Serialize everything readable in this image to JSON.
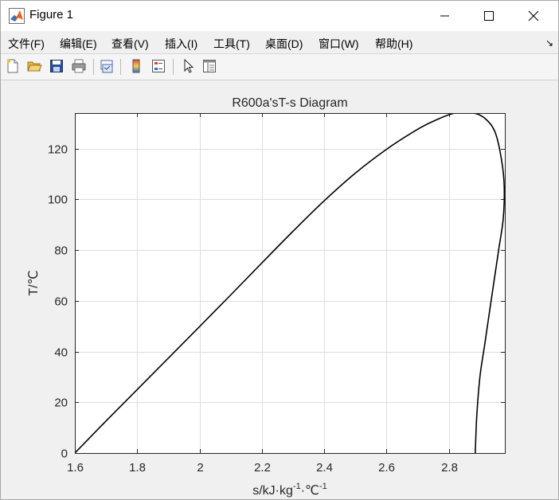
{
  "window": {
    "title": "Figure 1"
  },
  "menu": {
    "items": [
      {
        "label": "文件(F)"
      },
      {
        "label": "编辑(E)"
      },
      {
        "label": "查看(V)"
      },
      {
        "label": "插入(I)"
      },
      {
        "label": "工具(T)"
      },
      {
        "label": "桌面(D)"
      },
      {
        "label": "窗口(W)"
      },
      {
        "label": "帮助(H)"
      }
    ],
    "overflow_icon": "dock-arrow-icon"
  },
  "toolbar": {
    "icons": [
      "new-figure-icon",
      "open-file-icon",
      "save-icon",
      "print-icon",
      "link-plot-icon",
      "insert-colorbar-icon",
      "insert-legend-icon",
      "edit-plot-icon",
      "property-inspector-icon"
    ]
  },
  "chart_data": {
    "type": "line",
    "title": "R600a'sT-s Diagram",
    "xlabel_main": "s/kJ·kg",
    "xlabel_sup1": "-1",
    "xlabel_mid": "·℃",
    "xlabel_sup2": "-1",
    "ylabel": "T/℃",
    "xlim": [
      1.6,
      2.98
    ],
    "ylim": [
      0,
      134
    ],
    "xticks": [
      1.6,
      1.8,
      2,
      2.2,
      2.4,
      2.6,
      2.8
    ],
    "xtick_labels": [
      "1.6",
      "1.8",
      "2",
      "2.2",
      "2.4",
      "2.6",
      "2.8"
    ],
    "yticks": [
      0,
      20,
      40,
      60,
      80,
      100,
      120
    ],
    "ytick_labels": [
      "0",
      "20",
      "40",
      "60",
      "80",
      "100",
      "120"
    ],
    "grid": true,
    "line_color": "#000000",
    "series": [
      {
        "x": [
          1.6,
          1.7,
          1.8,
          1.9,
          2.0,
          2.1,
          2.2,
          2.3,
          2.4,
          2.5,
          2.6,
          2.7,
          2.76,
          2.82,
          2.88,
          2.92,
          2.95,
          2.97,
          2.978,
          2.975,
          2.96,
          2.945,
          2.93,
          2.915,
          2.9,
          2.89,
          2.885
        ],
        "y": [
          0,
          12.6,
          25.0,
          37.4,
          49.8,
          62.3,
          74.9,
          87.4,
          99.4,
          110.3,
          119.7,
          127.6,
          131.3,
          134,
          134,
          131.5,
          126,
          115,
          105,
          92.5,
          80,
          67.5,
          55,
          42.5,
          30,
          15,
          0
        ]
      }
    ]
  }
}
